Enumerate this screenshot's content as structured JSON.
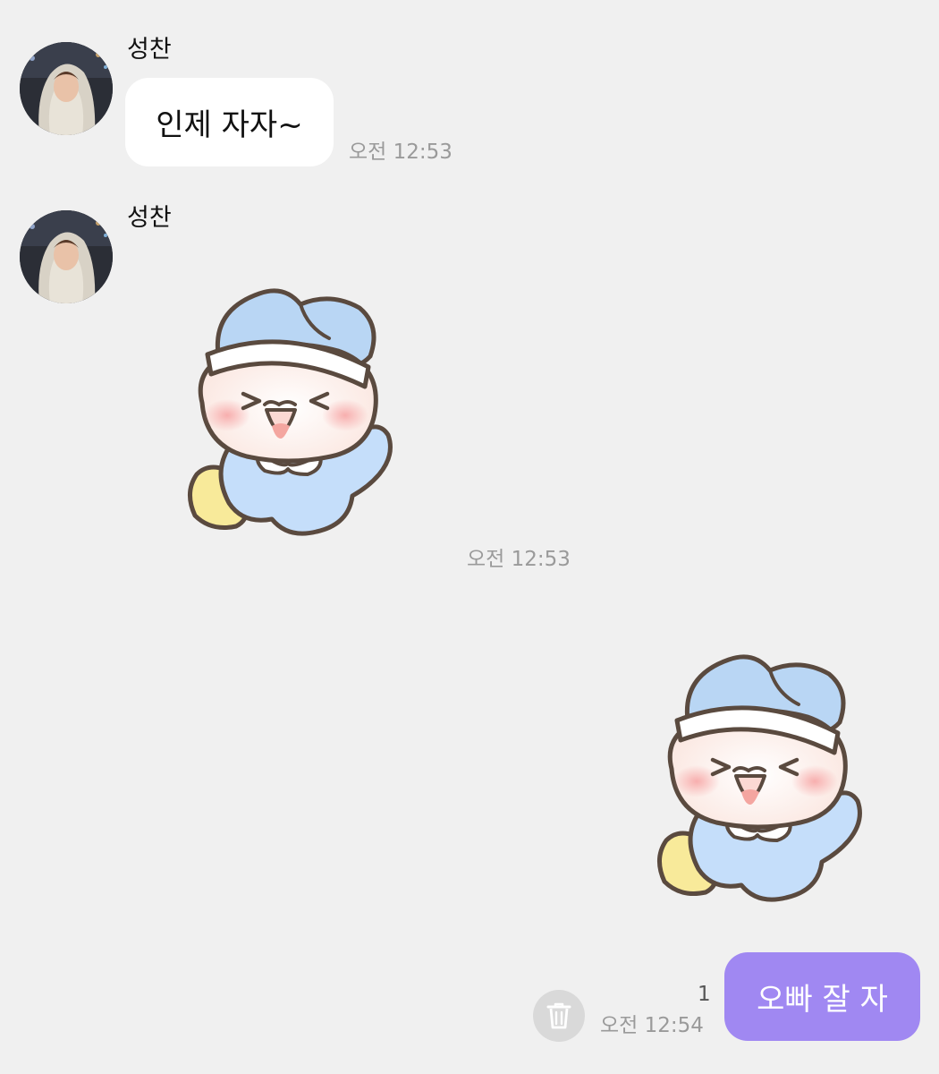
{
  "messages": {
    "incoming_text": {
      "sender": "성찬",
      "text": "인제 자자~",
      "time": "오전 12:53"
    },
    "incoming_sticker": {
      "sender": "성찬",
      "sticker": "baby-bunny-sticker",
      "time": "오전 12:53"
    },
    "outgoing_sticker": {
      "sticker": "baby-bunny-sticker"
    },
    "outgoing_text": {
      "text": "오빠 잘 자",
      "unread_count": "1",
      "time": "오전 12:54"
    }
  },
  "icons": {
    "avatar": "profile-photo",
    "delete": "trash-icon"
  },
  "colors": {
    "background": "#f0f0f0",
    "incoming_bubble": "#ffffff",
    "outgoing_bubble": "#a088f2",
    "timestamp": "#9a9a9a"
  }
}
